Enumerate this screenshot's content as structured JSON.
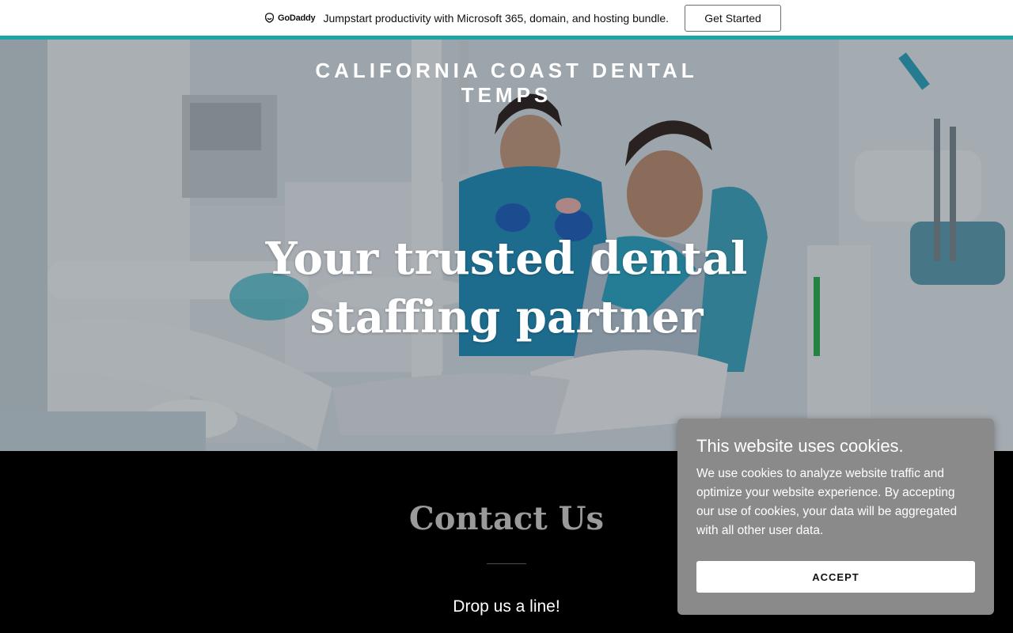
{
  "promo": {
    "logo_text": "GoDaddy",
    "message": "Jumpstart productivity with Microsoft 365, domain, and hosting bundle.",
    "cta_label": "Get Started"
  },
  "hero": {
    "brand": "CALIFORNIA COAST DENTAL TEMPS",
    "headline": "Your trusted dental staffing partner",
    "image_icon": "dental-clinic-photo"
  },
  "contact": {
    "title": "Contact Us",
    "subtitle": "Drop us a line!"
  },
  "cookie": {
    "title": "This website uses cookies.",
    "body": "We use cookies to analyze website traffic and optimize your website experience. By accepting our use of cookies, your data will be aggregated with all other user data.",
    "accept_label": "ACCEPT"
  },
  "colors": {
    "accent_teal": "#1aa6a6",
    "cookie_bg": "#8a8a8a",
    "contact_bg": "#000000"
  }
}
